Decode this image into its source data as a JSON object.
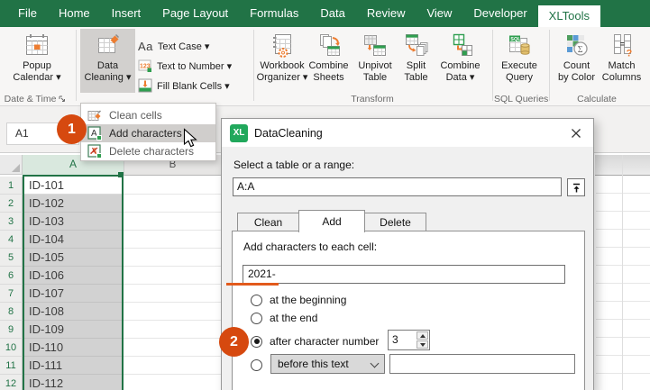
{
  "tabs": [
    "File",
    "Home",
    "Insert",
    "Page Layout",
    "Formulas",
    "Data",
    "Review",
    "View",
    "Developer",
    "XLTools"
  ],
  "ribbon": {
    "popup_calendar": {
      "l1": "Popup",
      "l2": "Calendar ▾"
    },
    "data_cleaning": {
      "l1": "Data",
      "l2": "Cleaning ▾"
    },
    "text_case_glyph": "Aa",
    "text_case": "Text Case ▾",
    "text_to_number": "Text to Number ▾",
    "fill_blank_cells": "Fill Blank Cells ▾",
    "workbook_organizer": {
      "l1": "Workbook",
      "l2": "Organizer ▾"
    },
    "combine_sheets": {
      "l1": "Combine",
      "l2": "Sheets"
    },
    "unpivot_table": {
      "l1": "Unpivot",
      "l2": "Table"
    },
    "split_table": {
      "l1": "Split",
      "l2": "Table"
    },
    "combine_data": {
      "l1": "Combine",
      "l2": "Data ▾"
    },
    "execute_query": {
      "l1": "Execute",
      "l2": "Query"
    },
    "count_by_color": {
      "l1": "Count",
      "l2": "by Color"
    },
    "match_columns": {
      "l1": "Match",
      "l2": "Columns"
    },
    "group_labels": {
      "date_time": "Date & Time",
      "transform": "Transform",
      "sql_queries": "SQL Queries",
      "calculate": "Calculate"
    }
  },
  "menu": {
    "items": [
      {
        "label": "Clean cells"
      },
      {
        "label": "Add characters"
      },
      {
        "label": "Delete characters"
      }
    ]
  },
  "formula_bar": {
    "name_box": "A1"
  },
  "annotations": {
    "step1": "1",
    "step2": "2"
  },
  "sheet": {
    "columns": [
      "A",
      "B"
    ],
    "rows": [
      {
        "n": "1",
        "v": "ID-101"
      },
      {
        "n": "2",
        "v": "ID-102"
      },
      {
        "n": "3",
        "v": "ID-103"
      },
      {
        "n": "4",
        "v": "ID-104"
      },
      {
        "n": "5",
        "v": "ID-105"
      },
      {
        "n": "6",
        "v": "ID-106"
      },
      {
        "n": "7",
        "v": "ID-107"
      },
      {
        "n": "8",
        "v": "ID-108"
      },
      {
        "n": "9",
        "v": "ID-109"
      },
      {
        "n": "10",
        "v": "ID-110"
      },
      {
        "n": "11",
        "v": "ID-111"
      },
      {
        "n": "12",
        "v": "ID-112"
      }
    ]
  },
  "dialog": {
    "logo": "XL",
    "title": "DataCleaning",
    "range_label": "Select a table or a range:",
    "range_value": "A:A",
    "tabs": [
      "Clean",
      "Add",
      "Delete"
    ],
    "active_tab": "Add",
    "add_section": {
      "label": "Add characters to each cell:",
      "value": "2021-"
    },
    "options": [
      {
        "label": "at the beginning",
        "selected": false
      },
      {
        "label": "at the end",
        "selected": false
      },
      {
        "label": "after character number",
        "selected": true,
        "value": "3"
      },
      {
        "label": "",
        "selected": false,
        "combo": "before this text",
        "text": ""
      }
    ]
  },
  "colors": {
    "excel_green": "#217346",
    "badge_orange": "#d6490f",
    "icon_orange": "#ed7d31",
    "icon_green": "#2f9e4f",
    "selection_gray": "#d2d2d2",
    "logo_green": "#21a85c",
    "column_header_fill": "#d9e8de"
  }
}
